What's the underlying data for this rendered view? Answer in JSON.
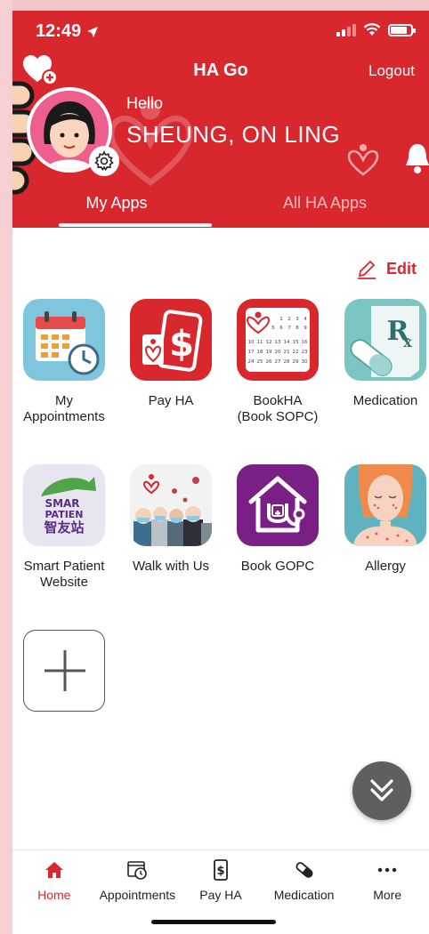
{
  "status_bar": {
    "time": "12:49"
  },
  "header": {
    "title": "HA Go",
    "logout_label": "Logout",
    "greeting": "Hello",
    "username": "SHEUNG, ON LING"
  },
  "tabs": [
    {
      "label": "My Apps",
      "active": true
    },
    {
      "label": "All HA Apps",
      "active": false
    }
  ],
  "edit_label": "Edit",
  "apps": [
    {
      "label": "My\nAppointments",
      "icon": "calendar-clock-icon"
    },
    {
      "label": "Pay HA",
      "icon": "dollar-card-icon"
    },
    {
      "label": "BookHA\n(Book SOPC)",
      "icon": "calendar-grid-icon"
    },
    {
      "label": "Medication",
      "icon": "rx-pill-icon"
    },
    {
      "label": "Smart Patient\nWebsite",
      "icon": "smart-patient-icon",
      "icon_text_1": "SMAR",
      "icon_text_2": "PATIEN",
      "icon_text_3": "智友站"
    },
    {
      "label": "Walk with Us",
      "icon": "people-virus-icon"
    },
    {
      "label": "Book GOPC",
      "icon": "house-stethoscope-icon"
    },
    {
      "label": "Allergy",
      "icon": "allergy-person-icon"
    }
  ],
  "bookha_icon": {
    "rows": [
      [
        "1",
        "2",
        "3",
        "4"
      ],
      [
        "5",
        "6",
        "7",
        "8",
        "9"
      ],
      [
        "10",
        "11",
        "12",
        "13",
        "14",
        "15",
        "16"
      ],
      [
        "17",
        "18",
        "19",
        "20",
        "21",
        "22",
        "23"
      ],
      [
        "24",
        "25",
        "26",
        "27",
        "28",
        "29",
        "30"
      ]
    ]
  },
  "bottom_nav": [
    {
      "label": "Home",
      "icon": "home-icon",
      "active": true
    },
    {
      "label": "Appointments",
      "icon": "calendar-clock-icon",
      "active": false
    },
    {
      "label": "Pay HA",
      "icon": "dollar-phone-icon",
      "active": false
    },
    {
      "label": "Medication",
      "icon": "pill-icon",
      "active": false
    },
    {
      "label": "More",
      "icon": "more-dots-icon",
      "active": false
    }
  ],
  "colors": {
    "brand": "#d9272e",
    "fab": "#5f5f5f",
    "medication_bg": "#7cc6c2",
    "gopc_bg": "#7a1f86"
  }
}
